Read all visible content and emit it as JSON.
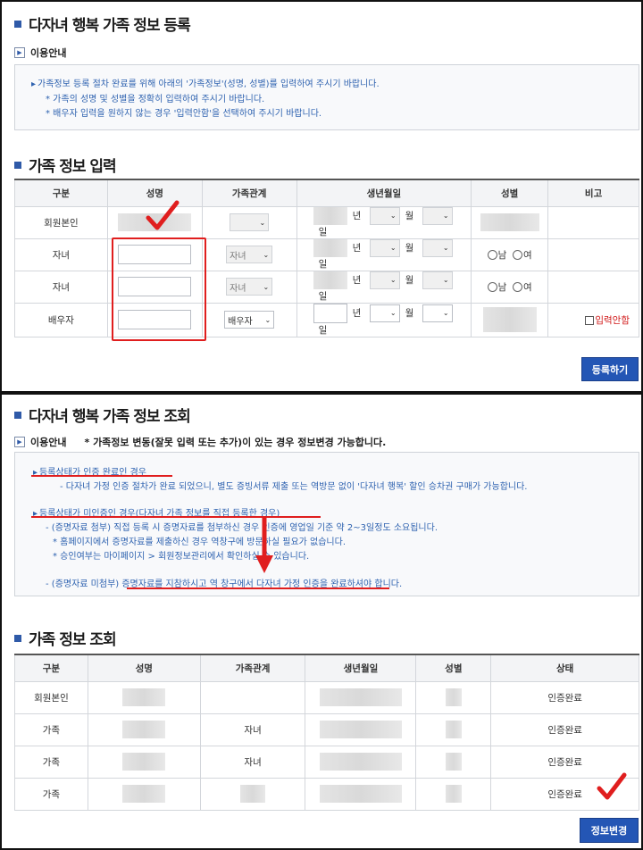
{
  "register": {
    "title": "다자녀 행복 가족 정보 등록",
    "guide_title": "이용안내",
    "guide_lines": [
      "가족정보 등록 절차 완료를 위해 아래의 '가족정보'(성명, 성별)를 입력하여 주시기 바랍니다.",
      "* 가족의 성명 및 성별을 정확히 입력하여 주시기 바랍니다.",
      "* 배우자 입력을 원하지 않는 경우 '입력안함'을 선택하여 주시기 바랍니다."
    ],
    "input_title": "가족 정보 입력",
    "columns": [
      "구분",
      "성명",
      "가족관계",
      "생년월일",
      "성별",
      "비고"
    ],
    "rows": [
      {
        "type": "회원본인",
        "relation": ""
      },
      {
        "type": "자녀",
        "relation": "자녀"
      },
      {
        "type": "자녀",
        "relation": "자녀"
      },
      {
        "type": "배우자",
        "relation": "배우자"
      }
    ],
    "unit_year": "년",
    "unit_month": "월",
    "unit_day": "일",
    "gender_male": "남",
    "gender_female": "여",
    "no_input_label": "입력안함",
    "submit_label": "등록하기"
  },
  "lookup": {
    "title": "다자녀 행복 가족 정보 조회",
    "guide_title": "이용안내",
    "guide_extra": "* 가족정보 변동(잘못 입력 또는 추가)이 있는 경우 정보변경 가능합니다.",
    "lines": [
      "등록상태가 인증 완료인 경우",
      "- 다자녀 가정 인증 절차가 완료 되었으니, 별도 증빙서류 제출 또는 역방문 없이 '다자녀 행복' 할인 승차권 구매가 가능합니다.",
      "등록상태가 미인증인 경우(다자녀 가족 정보를 직접 등록한 경우)",
      "- (증명자료 첨부) 직접 등록 시 증명자료를 첨부하신 경우 인증에 영업일 기준 약 2~3일정도 소요됩니다.",
      "* 홈페이지에서 증명자료를 제출하신 경우 역창구에 방문하실 필요가 없습니다.",
      "* 승인여부는 마이페이지 > 회원정보관리에서 확인하실 수 있습니다.",
      "- (증명자료 미첨부) 증명자료를 지참하시고 역 창구에서 다자녀 가정 인증을 완료하셔야 합니다."
    ],
    "table_title": "가족 정보 조회",
    "columns": [
      "구분",
      "성명",
      "가족관계",
      "생년월일",
      "성별",
      "상태"
    ],
    "rows": [
      {
        "type": "회원본인",
        "relation": "",
        "status": "인증완료"
      },
      {
        "type": "가족",
        "relation": "자녀",
        "status": "인증완료"
      },
      {
        "type": "가족",
        "relation": "자녀",
        "status": "인증완료"
      },
      {
        "type": "가족",
        "relation": "",
        "status": "인증완료"
      }
    ],
    "change_label": "정보변경"
  },
  "colors": {
    "accent_blue": "#2456b5",
    "annotation_red": "#e01e1e",
    "guide_text_blue": "#2f63b0"
  }
}
